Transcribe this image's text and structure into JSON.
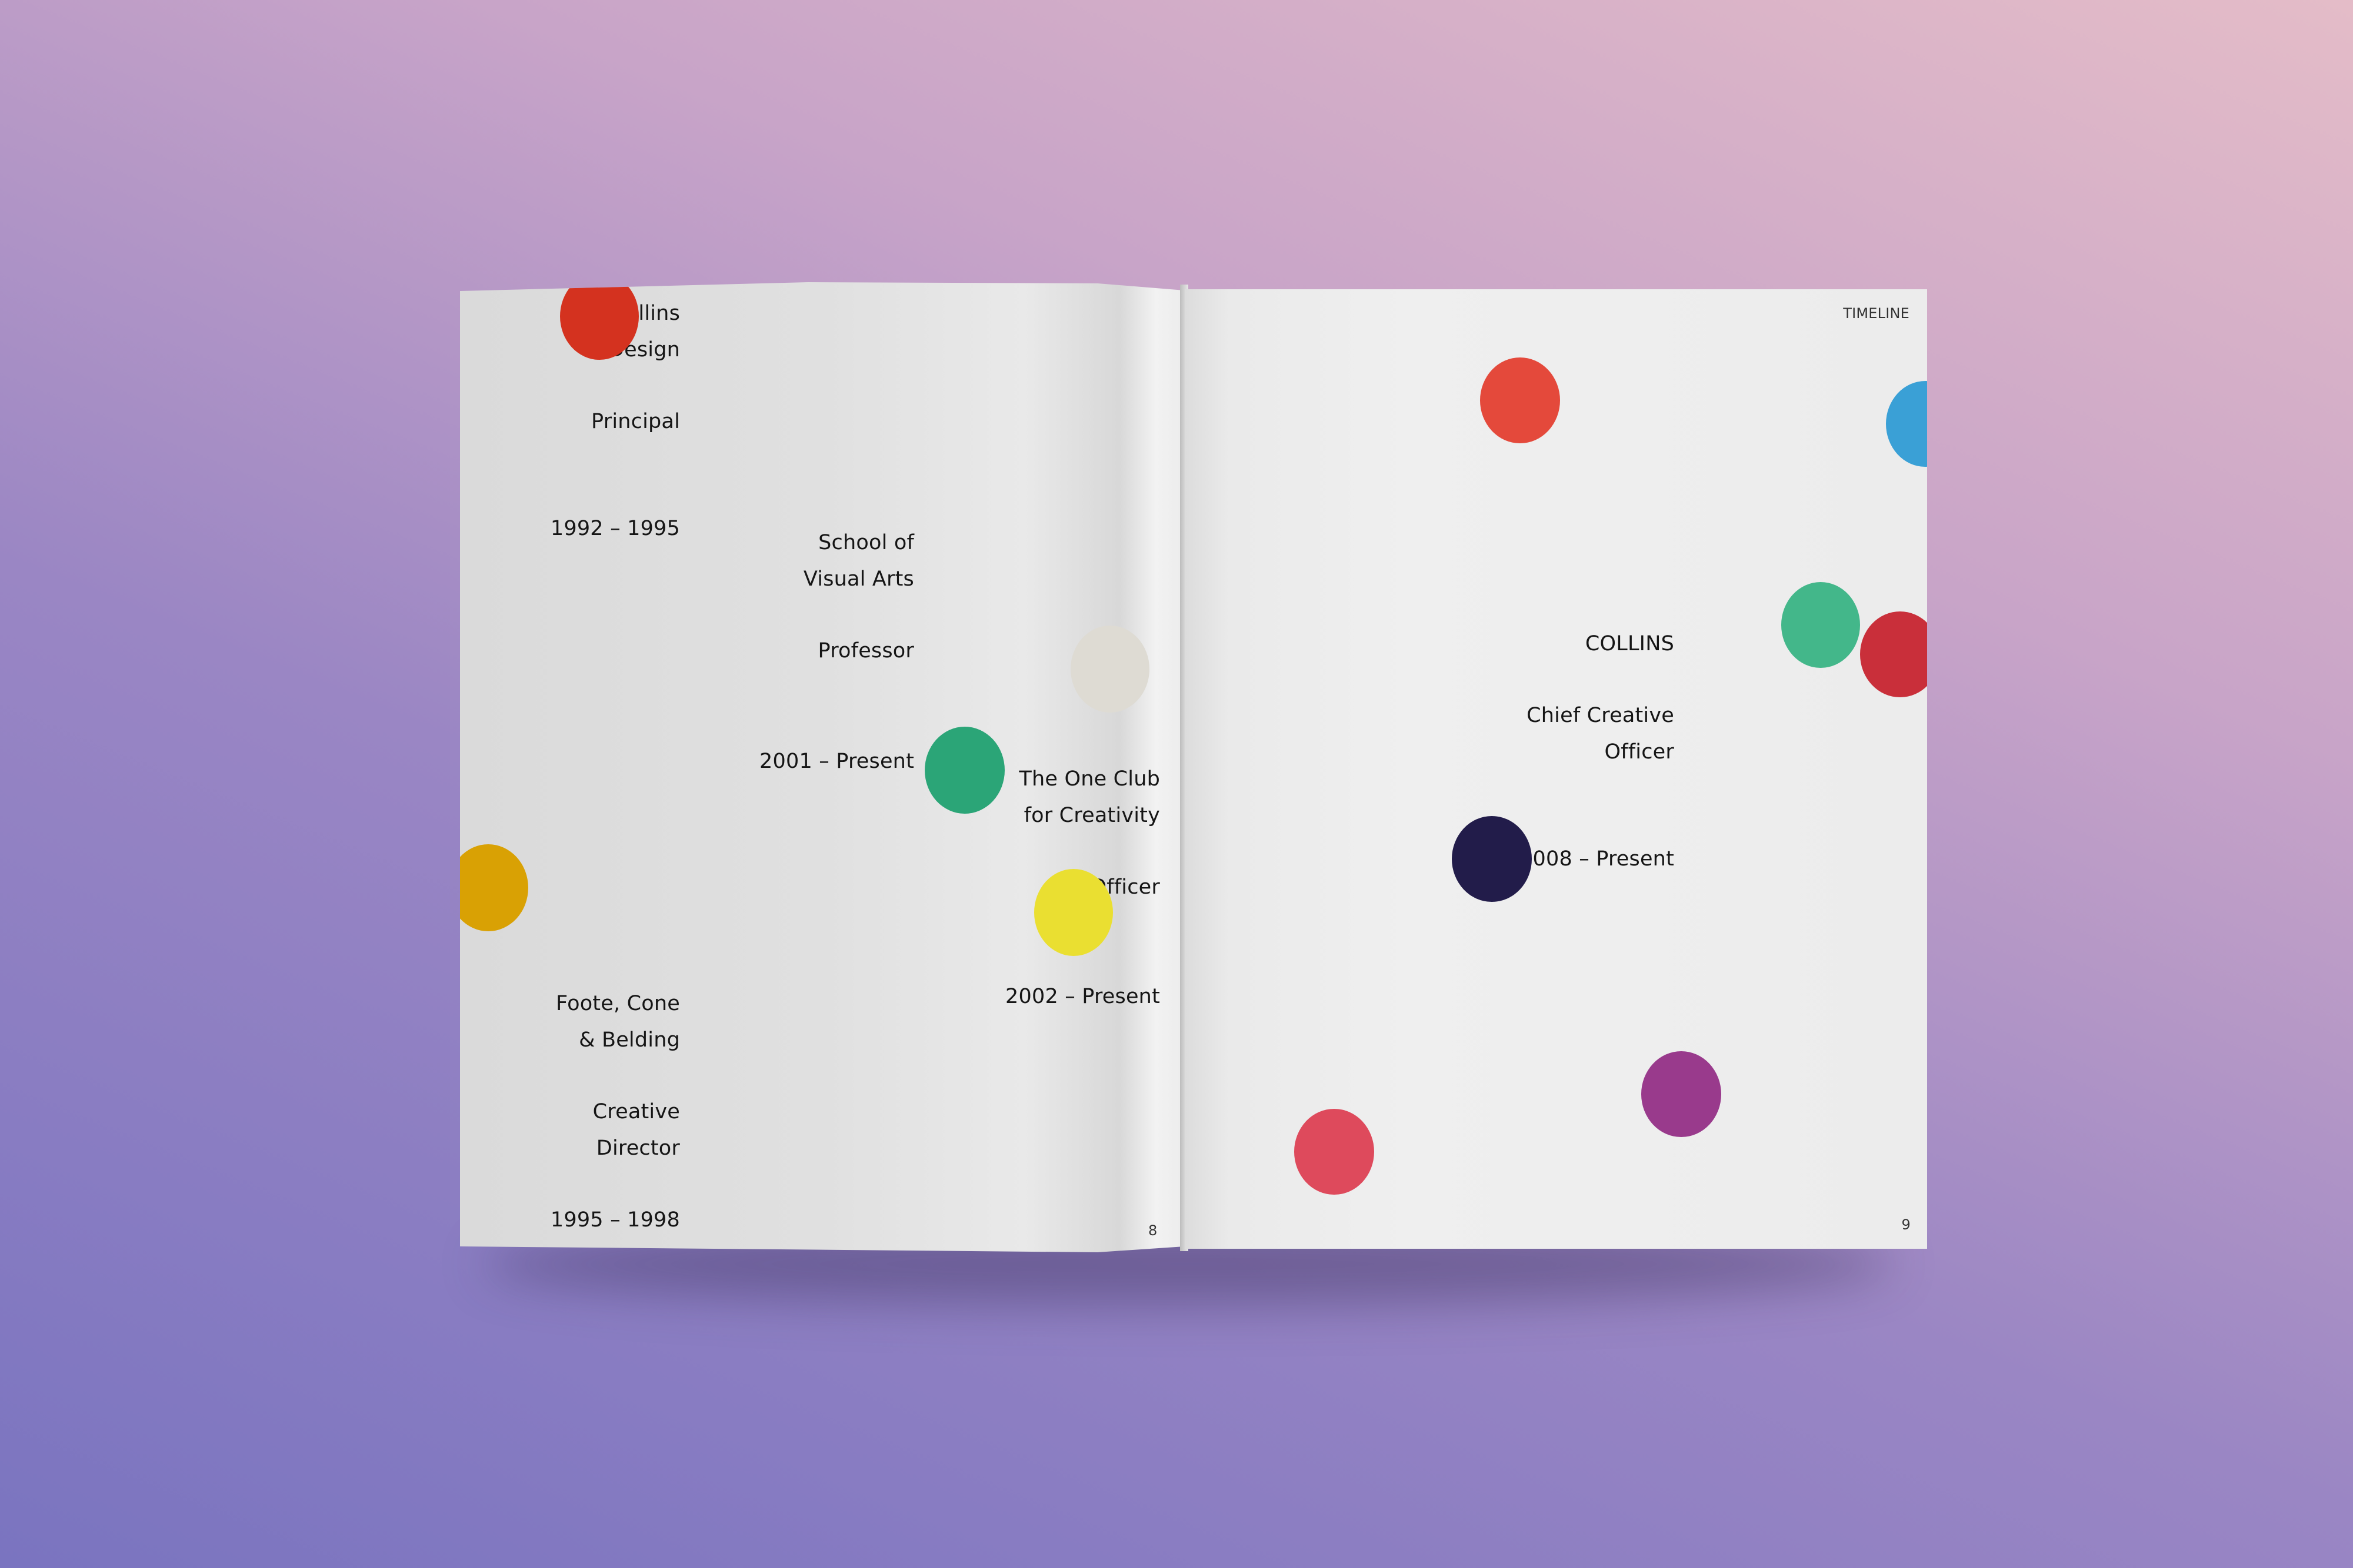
{
  "left_page": {
    "entries": [
      {
        "org_line1": "Collins",
        "org_line2": "Design",
        "role": "Principal",
        "years": "1992 – 1995"
      },
      {
        "org_line1": "School of",
        "org_line2": "Visual Arts",
        "role": "Professor",
        "years": "2001 – Present"
      },
      {
        "org_line1": "The One Club",
        "org_line2": "for Creativity",
        "role": "Officer",
        "years": "2002 – Present"
      },
      {
        "org_line1": "Foote, Cone",
        "org_line2": "& Belding",
        "role_line1": "Creative",
        "role_line2": "Director",
        "years": "1995 – 1998"
      }
    ],
    "page_number": "8"
  },
  "right_page": {
    "header": "TIMELINE",
    "entry": {
      "org": "COLLINS",
      "role_line1": "Chief Creative",
      "role_line2": "Officer",
      "years": "2008 – Present"
    },
    "page_number": "9"
  },
  "colors": {
    "red_orange": "#d4321f",
    "teal_green": "#2ba577",
    "cream": "#dedbd3",
    "mustard": "#d9a104",
    "yellow": "#eadf31",
    "coral_red": "#e4493b",
    "sky_blue": "#3aa0d6",
    "mint_green": "#43b78a",
    "crimson": "#c92f3a",
    "navy": "#221c4a",
    "magenta_purple": "#993a8c",
    "rose_red": "#de4a5c"
  }
}
